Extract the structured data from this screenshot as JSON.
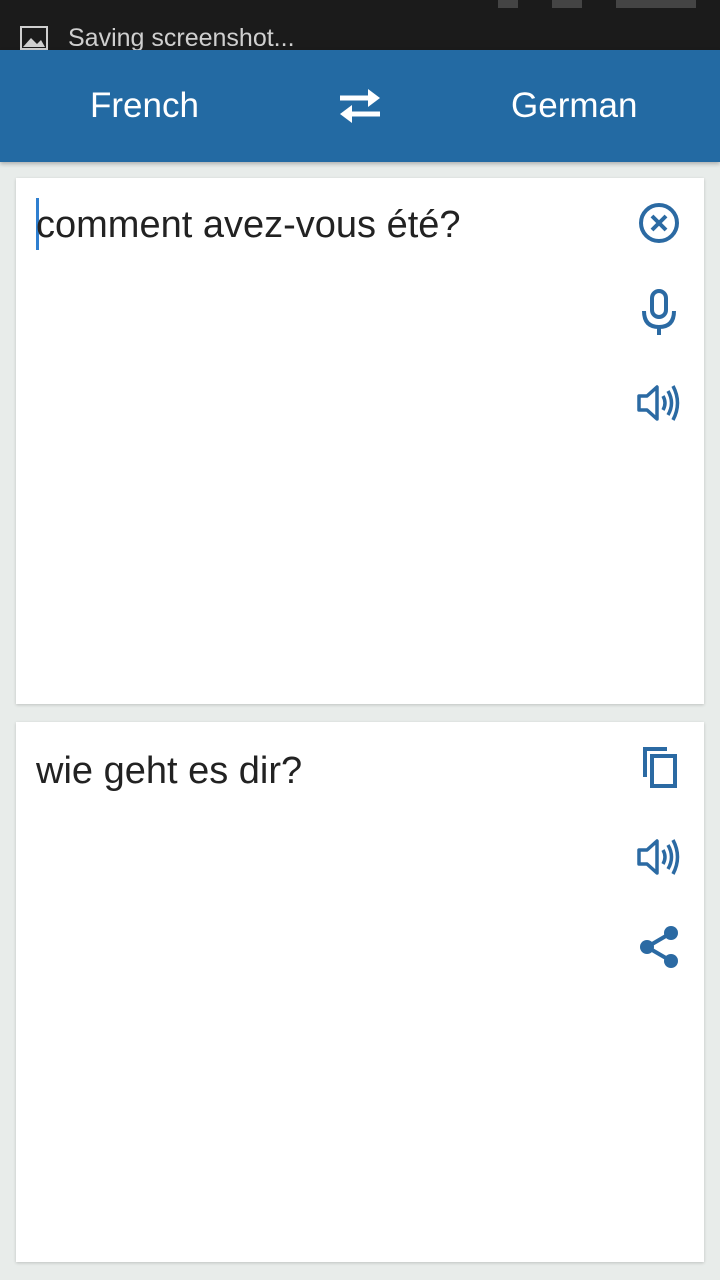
{
  "status_bar": {
    "notification_text": "Saving screenshot..."
  },
  "toolbar": {
    "source_language": "French",
    "target_language": "German",
    "swap_icon": "swap-arrows-icon"
  },
  "source_panel": {
    "text": "comment avez-vous été?",
    "icons": [
      "clear-icon",
      "microphone-icon",
      "speaker-icon"
    ]
  },
  "target_panel": {
    "text": "wie geht es dir?",
    "icons": [
      "copy-icon",
      "speaker-icon",
      "share-icon"
    ]
  },
  "colors": {
    "accent": "#236aa3",
    "icon": "#2b6aa3",
    "background": "#e8ecea",
    "status_bar": "#1b1b1b"
  }
}
